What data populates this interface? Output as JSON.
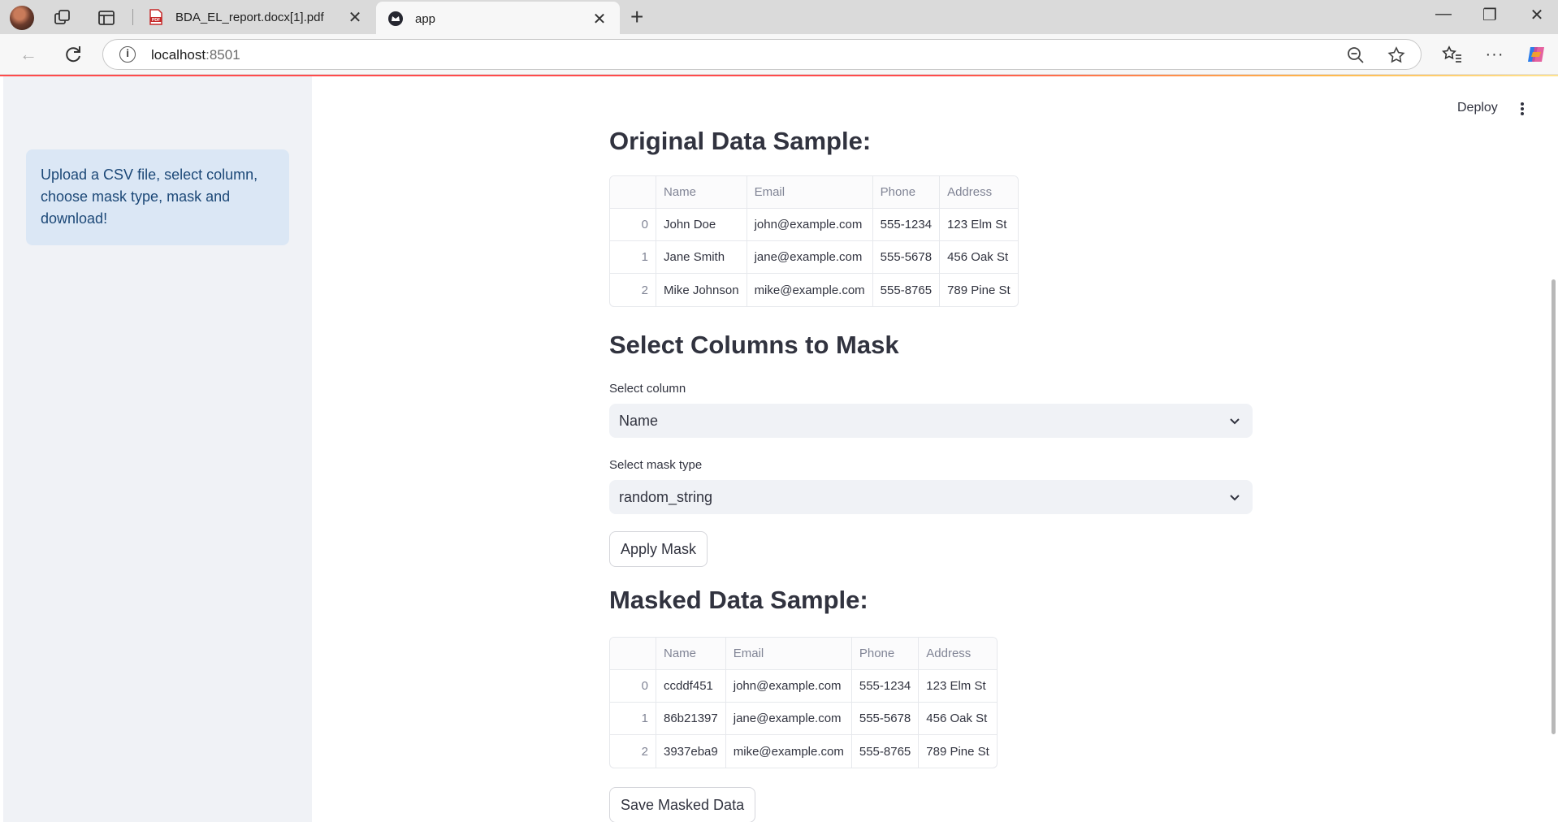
{
  "browser": {
    "tabs": [
      {
        "title": "BDA_EL_report.docx[1].pdf",
        "active": false
      },
      {
        "title": "app",
        "active": true
      }
    ],
    "url_host": "localhost",
    "url_port": ":8501"
  },
  "sidebar": {
    "info_text": "Upload a CSV file, select column, choose mask type, mask and download!"
  },
  "header": {
    "deploy_label": "Deploy"
  },
  "original": {
    "title": "Original Data Sample:",
    "columns": [
      "Name",
      "Email",
      "Phone",
      "Address"
    ],
    "rows": [
      {
        "idx": "0",
        "cells": [
          "John Doe",
          "john@example.com",
          "555-1234",
          "123 Elm St"
        ]
      },
      {
        "idx": "1",
        "cells": [
          "Jane Smith",
          "jane@example.com",
          "555-5678",
          "456 Oak St"
        ]
      },
      {
        "idx": "2",
        "cells": [
          "Mike Johnson",
          "mike@example.com",
          "555-8765",
          "789 Pine St"
        ]
      }
    ]
  },
  "select_section": {
    "title": "Select Columns to Mask",
    "column_label": "Select column",
    "column_value": "Name",
    "mask_label": "Select mask type",
    "mask_value": "random_string",
    "apply_button": "Apply Mask"
  },
  "masked": {
    "title": "Masked Data Sample:",
    "columns": [
      "Name",
      "Email",
      "Phone",
      "Address"
    ],
    "rows": [
      {
        "idx": "0",
        "cells": [
          "ccddf451",
          "john@example.com",
          "555-1234",
          "123 Elm St"
        ]
      },
      {
        "idx": "1",
        "cells": [
          "86b21397",
          "jane@example.com",
          "555-5678",
          "456 Oak St"
        ]
      },
      {
        "idx": "2",
        "cells": [
          "3937eba9",
          "mike@example.com",
          "555-8765",
          "789 Pine St"
        ]
      }
    ],
    "save_button": "Save Masked Data"
  }
}
